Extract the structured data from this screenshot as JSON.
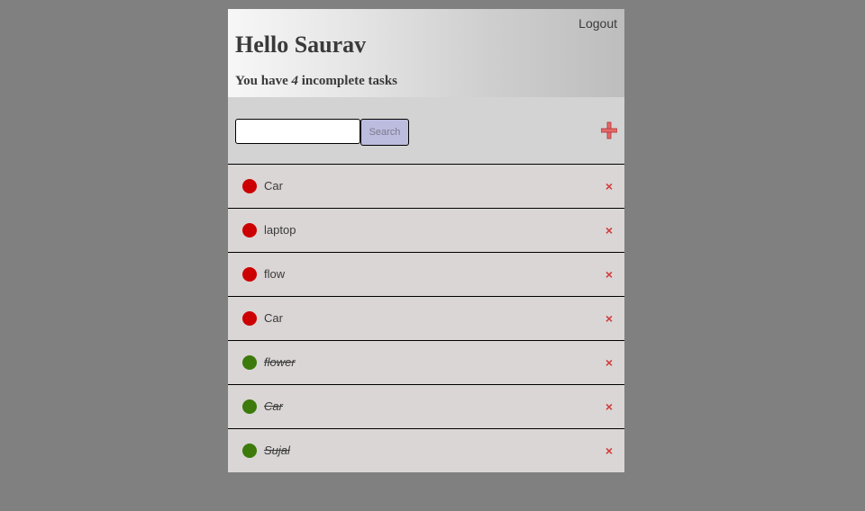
{
  "header": {
    "logout_label": "Logout",
    "greeting": "Hello Saurav",
    "summary_prefix": "You have ",
    "incomplete_count": "4",
    "summary_suffix": " incomplete tasks"
  },
  "toolbar": {
    "search_value": "",
    "search_button_label": "Search",
    "add_icon": "plus-icon"
  },
  "colors": {
    "incomplete": "#cc0000",
    "complete": "#3b7a0b",
    "delete": "#d33a3a"
  },
  "tasks": [
    {
      "label": "Car",
      "completed": false,
      "delete_label": "×"
    },
    {
      "label": "laptop",
      "completed": false,
      "delete_label": "×"
    },
    {
      "label": "flow",
      "completed": false,
      "delete_label": "×"
    },
    {
      "label": "Car",
      "completed": false,
      "delete_label": "×"
    },
    {
      "label": "flower",
      "completed": true,
      "delete_label": "×"
    },
    {
      "label": "Car",
      "completed": true,
      "delete_label": "×"
    },
    {
      "label": "Sujal",
      "completed": true,
      "delete_label": "×"
    }
  ]
}
